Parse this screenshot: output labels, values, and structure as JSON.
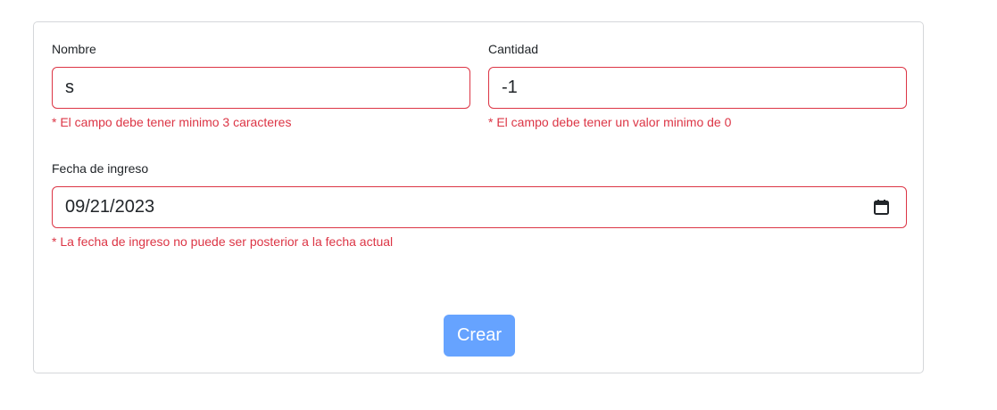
{
  "form": {
    "nombre": {
      "label": "Nombre",
      "value": "s",
      "error": "* El campo debe tener minimo 3 caracteres"
    },
    "cantidad": {
      "label": "Cantidad",
      "value": "-1",
      "error": "* El campo debe tener un valor minimo de 0"
    },
    "fecha": {
      "label": "Fecha de ingreso",
      "value": "09/21/2023",
      "error": "* La fecha de ingreso no puede ser posterior a la fecha actual",
      "icon": "calendar-icon"
    },
    "submit_label": "Crear"
  },
  "colors": {
    "error": "#dc3545",
    "button": "#66a3ff",
    "border": "#d5d7da"
  }
}
